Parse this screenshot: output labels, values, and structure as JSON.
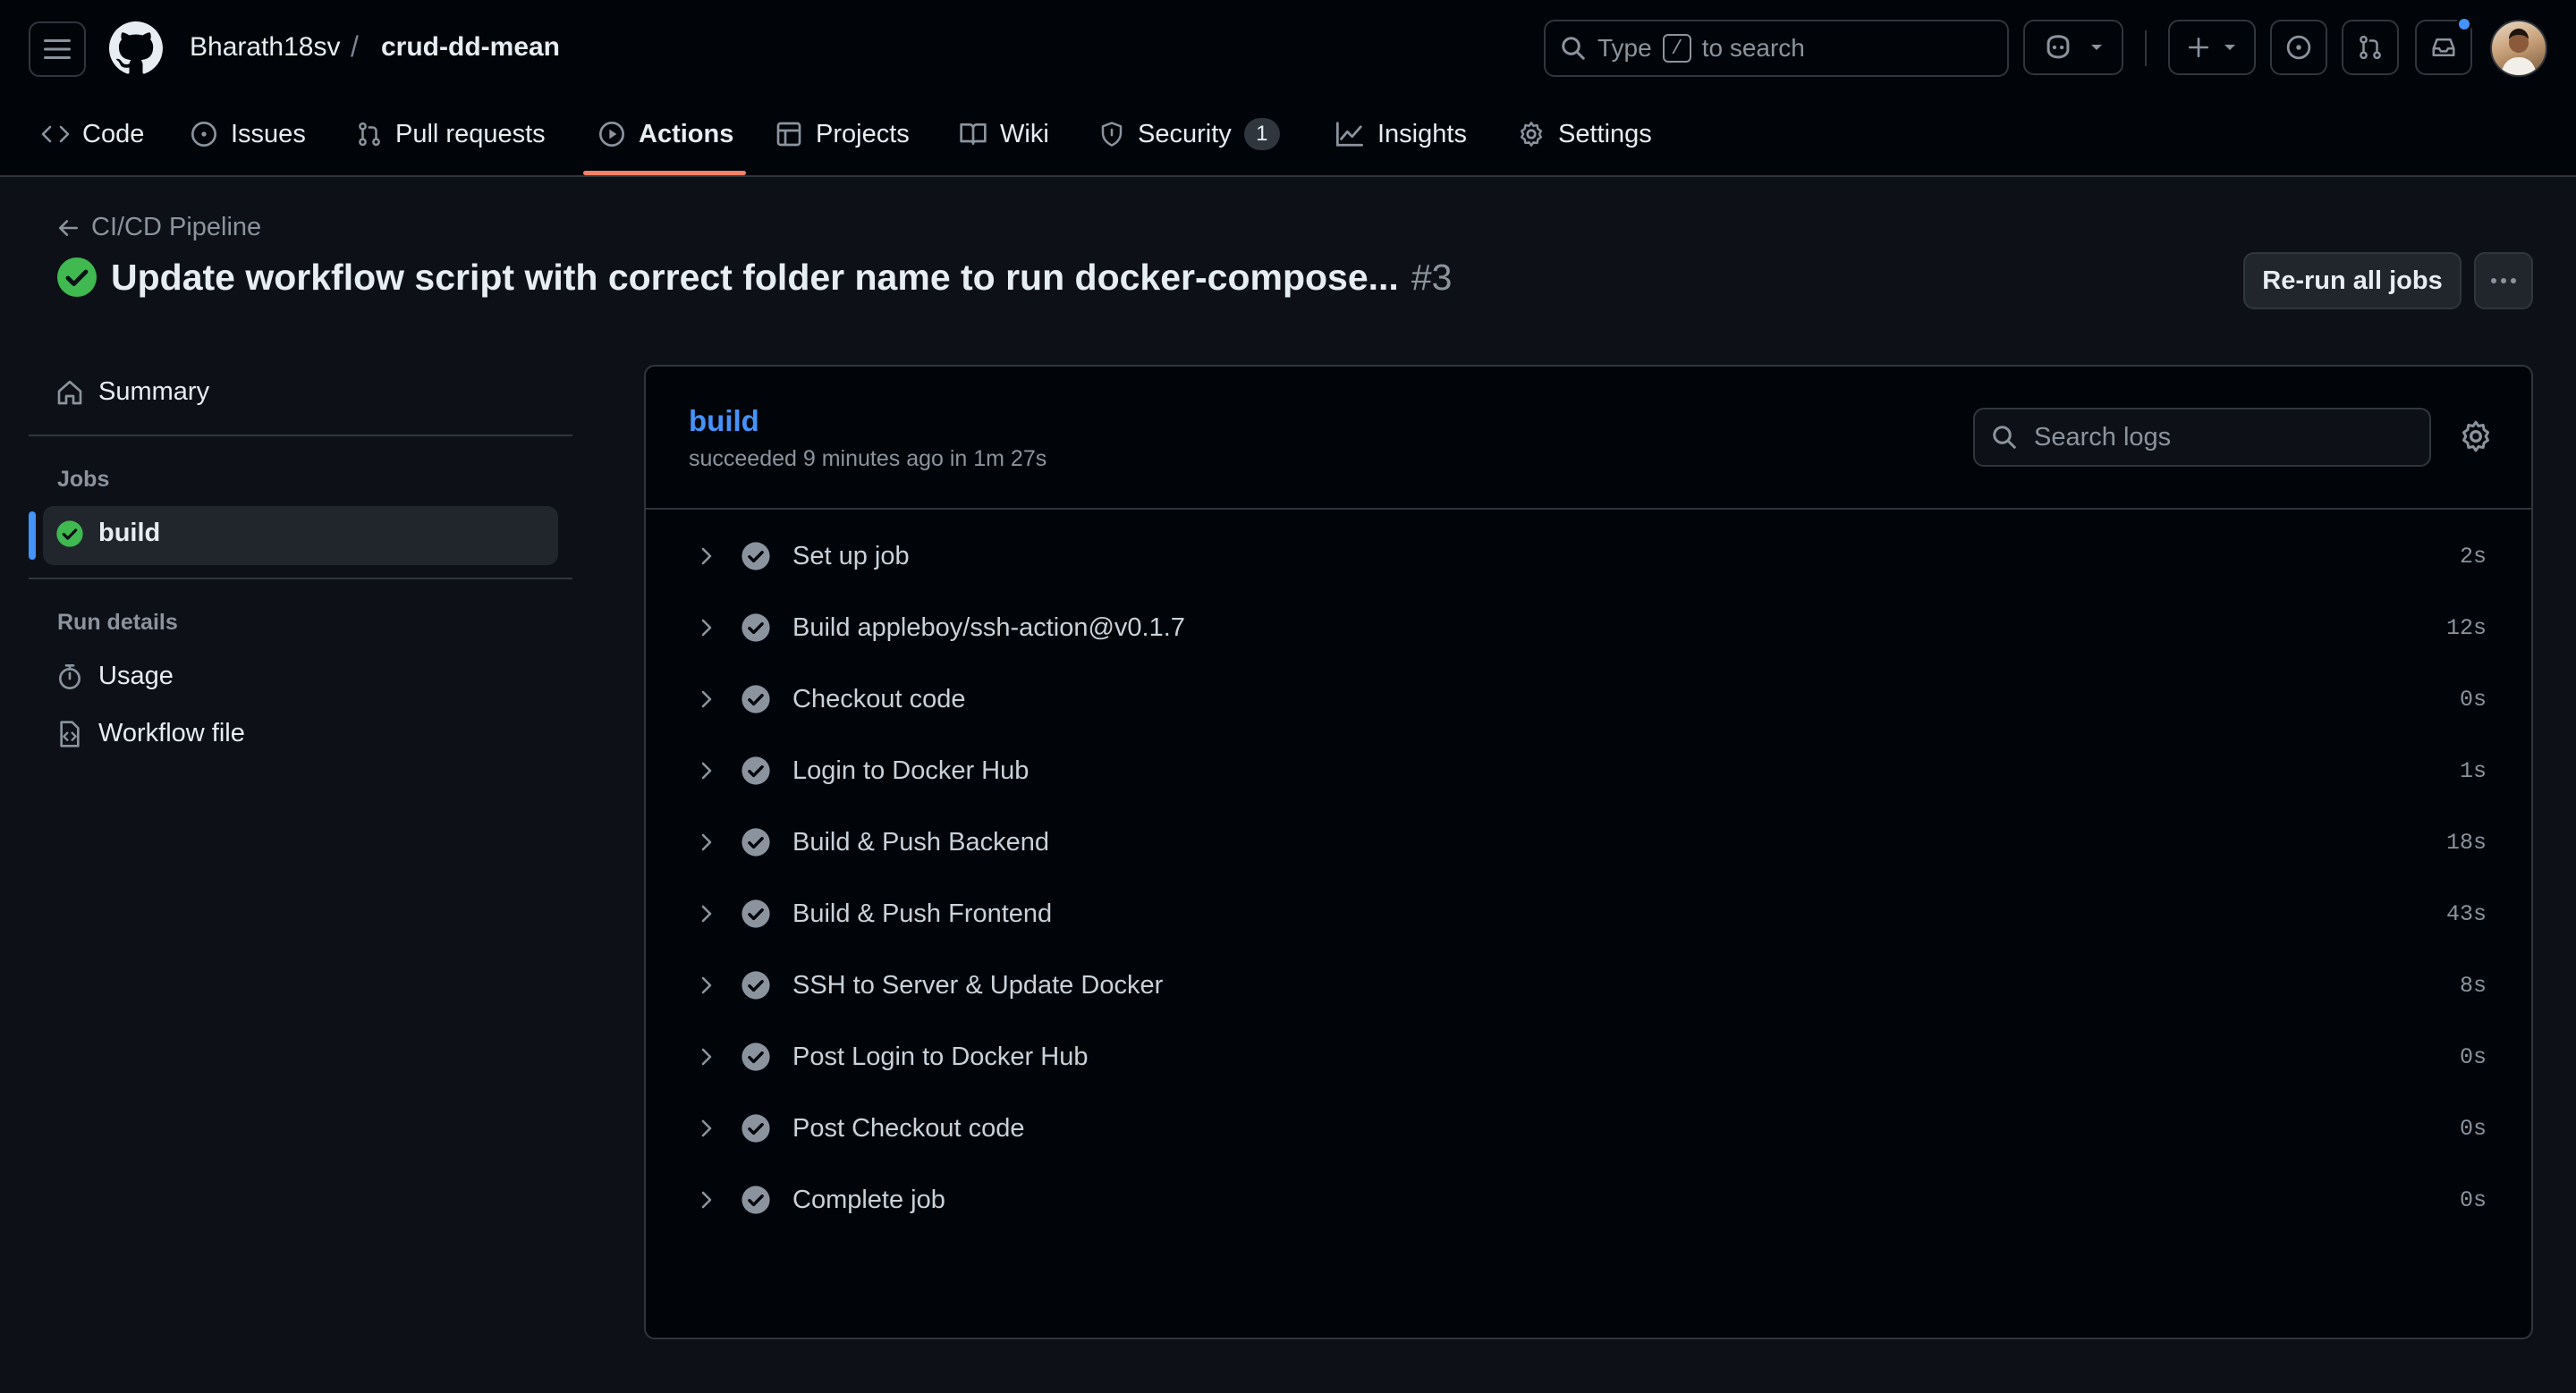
{
  "header": {
    "owner": "Bharath18sv",
    "separator": "/",
    "repo": "crud-dd-mean",
    "search_prefix": "Type",
    "search_key": "/",
    "search_suffix": "to search"
  },
  "tabs": [
    {
      "label": "Code",
      "icon": "code-icon"
    },
    {
      "label": "Issues",
      "icon": "issue-icon"
    },
    {
      "label": "Pull requests",
      "icon": "pull-request-icon"
    },
    {
      "label": "Actions",
      "icon": "play-icon",
      "active": true
    },
    {
      "label": "Projects",
      "icon": "table-icon"
    },
    {
      "label": "Wiki",
      "icon": "book-icon"
    },
    {
      "label": "Security",
      "icon": "shield-icon",
      "count": "1"
    },
    {
      "label": "Insights",
      "icon": "graph-icon"
    },
    {
      "label": "Settings",
      "icon": "gear-icon"
    }
  ],
  "run": {
    "workflow_name": "CI/CD Pipeline",
    "title": "Update workflow script with correct folder name to run docker-compose...",
    "number": "#3",
    "rerun_label": "Re-run all jobs"
  },
  "sidebar": {
    "summary_label": "Summary",
    "jobs_heading": "Jobs",
    "job_label": "build",
    "run_details_heading": "Run details",
    "usage_label": "Usage",
    "workflow_file_label": "Workflow file"
  },
  "job": {
    "name": "build",
    "meta": "succeeded 9 minutes ago in 1m 27s",
    "search_placeholder": "Search logs",
    "steps": [
      {
        "name": "Set up job",
        "duration": "2s"
      },
      {
        "name": "Build appleboy/ssh-action@v0.1.7",
        "duration": "12s"
      },
      {
        "name": "Checkout code",
        "duration": "0s"
      },
      {
        "name": "Login to Docker Hub",
        "duration": "1s"
      },
      {
        "name": "Build & Push Backend",
        "duration": "18s"
      },
      {
        "name": "Build & Push Frontend",
        "duration": "43s"
      },
      {
        "name": "SSH to Server & Update Docker",
        "duration": "8s"
      },
      {
        "name": "Post Login to Docker Hub",
        "duration": "0s"
      },
      {
        "name": "Post Checkout code",
        "duration": "0s"
      },
      {
        "name": "Complete job",
        "duration": "0s"
      }
    ]
  },
  "colors": {
    "success": "#3fb950",
    "accent": "#4493f8",
    "tab_underline": "#f78166"
  }
}
